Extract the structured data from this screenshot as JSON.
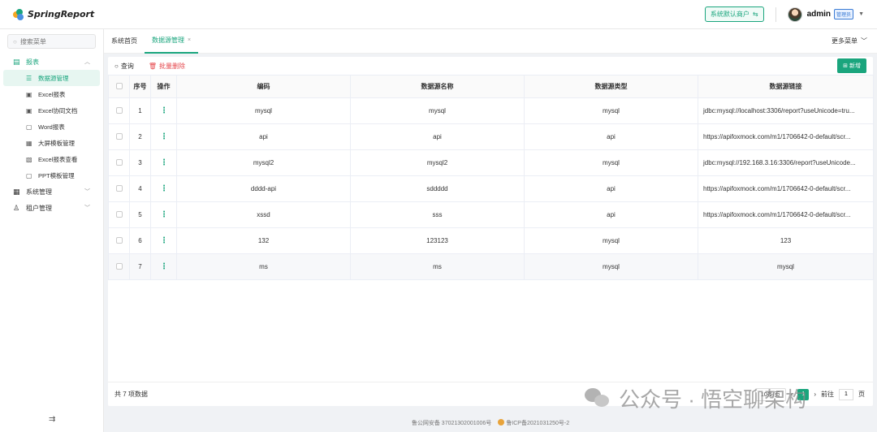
{
  "app": {
    "name": "SpringReport"
  },
  "header": {
    "tenant_label": "系统默认商户",
    "user_name": "admin",
    "role_badge": "管理员"
  },
  "sidebar": {
    "search_placeholder": "搜索菜单",
    "groups": [
      {
        "label": "报表",
        "items": [
          "数据源管理",
          "Excel报表",
          "Excel协同文档",
          "Word报表",
          "大屏模板管理",
          "Excel报表查看",
          "PPT模板管理"
        ]
      },
      {
        "label": "系统管理"
      },
      {
        "label": "租户管理"
      }
    ]
  },
  "tabs": [
    {
      "label": "系统首页"
    },
    {
      "label": "数据源管理"
    }
  ],
  "more_menu": "更多菜单",
  "toolbar": {
    "search": "查询",
    "batch_delete": "批量删除",
    "add": "新增"
  },
  "table": {
    "headers": [
      "序号",
      "操作",
      "编码",
      "数据源名称",
      "数据源类型",
      "数据源链接"
    ],
    "rows": [
      {
        "no": "1",
        "code": "mysql",
        "name": "mysql",
        "type": "mysql",
        "link": "jdbc:mysql://localhost:3306/report?useUnicode=tru..."
      },
      {
        "no": "2",
        "code": "api",
        "name": "api",
        "type": "api",
        "link": "https://apifoxmock.com/m1/1706642-0-default/scr..."
      },
      {
        "no": "3",
        "code": "mysql2",
        "name": "mysql2",
        "type": "mysql",
        "link": "jdbc:mysql://192.168.3.16:3306/report?useUnicode..."
      },
      {
        "no": "4",
        "code": "dddd-api",
        "name": "sddddd",
        "type": "api",
        "link": "https://apifoxmock.com/m1/1706642-0-default/scr..."
      },
      {
        "no": "5",
        "code": "xssd",
        "name": "sss",
        "type": "api",
        "link": "https://apifoxmock.com/m1/1706642-0-default/scr..."
      },
      {
        "no": "6",
        "code": "132",
        "name": "123123",
        "type": "mysql",
        "link": "123"
      },
      {
        "no": "7",
        "code": "ms",
        "name": "ms",
        "type": "mysql",
        "link": "mysql"
      }
    ]
  },
  "footer": {
    "total": "共 7 项数据",
    "page_size": "10条/页",
    "current_page": "1",
    "goto_label": "前往",
    "goto_value": "1",
    "page_suffix": "页"
  },
  "watermark": "公众号 · 悟空聊架构",
  "page_footer": {
    "police": "鲁公网安备 37021302001006号",
    "icp": "鲁ICP备2021031250号-2"
  },
  "colors": {
    "accent": "#1aa57d",
    "danger": "#e5484d"
  }
}
